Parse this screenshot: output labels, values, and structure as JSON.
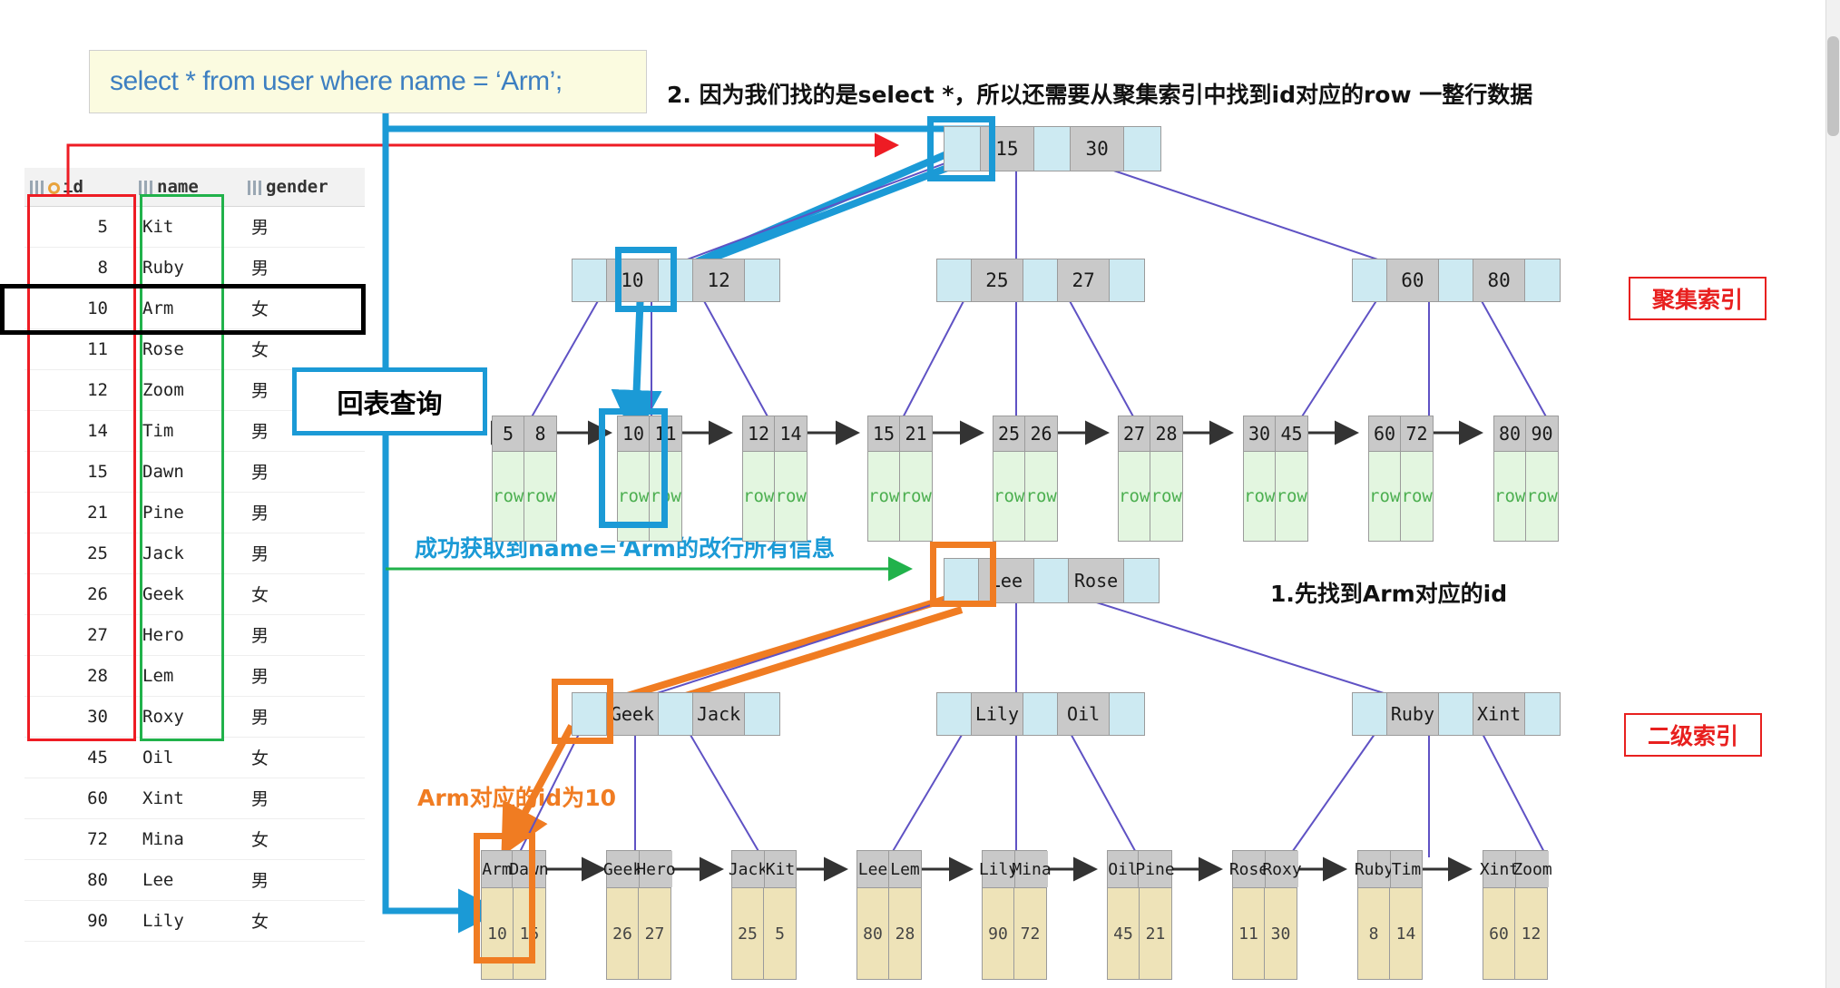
{
  "sql": {
    "query": "select * from user where name = ‘Arm’;"
  },
  "table": {
    "columns": [
      "id",
      "name",
      "gender"
    ],
    "rows": [
      [
        "5",
        "Kit",
        "男"
      ],
      [
        "8",
        "Ruby",
        "男"
      ],
      [
        "10",
        "Arm",
        "女"
      ],
      [
        "11",
        "Rose",
        "女"
      ],
      [
        "12",
        "Zoom",
        "男"
      ],
      [
        "14",
        "Tim",
        "男"
      ],
      [
        "15",
        "Dawn",
        "男"
      ],
      [
        "21",
        "Pine",
        "男"
      ],
      [
        "25",
        "Jack",
        "男"
      ],
      [
        "26",
        "Geek",
        "女"
      ],
      [
        "27",
        "Hero",
        "男"
      ],
      [
        "28",
        "Lem",
        "男"
      ],
      [
        "30",
        "Roxy",
        "男"
      ],
      [
        "45",
        "Oil",
        "女"
      ],
      [
        "60",
        "Xint",
        "男"
      ],
      [
        "72",
        "Mina",
        "女"
      ],
      [
        "80",
        "Lee",
        "男"
      ],
      [
        "90",
        "Lily",
        "女"
      ]
    ]
  },
  "annotations": {
    "step2": "2. 因为我们找的是select *，所以还需要从聚集索引中找到id对应的row 一整行数据",
    "step1": "1.先找到Arm对应的id",
    "success": "成功获取到name=‘Arm的改行所有信息",
    "arm_id": "Arm对应的id为10",
    "back_to_table": "回表查询",
    "clustered_label": "聚集索引",
    "secondary_label": "二级索引"
  },
  "clustered_index": {
    "root": [
      "15",
      "30"
    ],
    "internal": [
      [
        "10",
        "12"
      ],
      [
        "25",
        "27"
      ],
      [
        "60",
        "80"
      ]
    ],
    "leaves": [
      {
        "keys": [
          "5",
          "8"
        ],
        "vals": [
          "row",
          "row"
        ]
      },
      {
        "keys": [
          "10",
          "11"
        ],
        "vals": [
          "row",
          "row"
        ]
      },
      {
        "keys": [
          "12",
          "14"
        ],
        "vals": [
          "row",
          "row"
        ]
      },
      {
        "keys": [
          "15",
          "21"
        ],
        "vals": [
          "row",
          "row"
        ]
      },
      {
        "keys": [
          "25",
          "26"
        ],
        "vals": [
          "row",
          "row"
        ]
      },
      {
        "keys": [
          "27",
          "28"
        ],
        "vals": [
          "row",
          "row"
        ]
      },
      {
        "keys": [
          "30",
          "45"
        ],
        "vals": [
          "row",
          "row"
        ]
      },
      {
        "keys": [
          "60",
          "72"
        ],
        "vals": [
          "row",
          "row"
        ]
      },
      {
        "keys": [
          "80",
          "90"
        ],
        "vals": [
          "row",
          "row"
        ]
      }
    ]
  },
  "secondary_index": {
    "root": [
      "Lee",
      "Rose"
    ],
    "internal": [
      [
        "Geek",
        "Jack"
      ],
      [
        "Lily",
        "Oil"
      ],
      [
        "Ruby",
        "Xint"
      ]
    ],
    "leaves": [
      {
        "keys": [
          "Arm",
          "Dawn"
        ],
        "vals": [
          "10",
          "15"
        ]
      },
      {
        "keys": [
          "Geek",
          "Hero"
        ],
        "vals": [
          "26",
          "27"
        ]
      },
      {
        "keys": [
          "Jack",
          "Kit"
        ],
        "vals": [
          "25",
          "5"
        ]
      },
      {
        "keys": [
          "Lee",
          "Lem"
        ],
        "vals": [
          "80",
          "28"
        ]
      },
      {
        "keys": [
          "Lily",
          "Mina"
        ],
        "vals": [
          "90",
          "72"
        ]
      },
      {
        "keys": [
          "Oil",
          "Pine"
        ],
        "vals": [
          "45",
          "21"
        ]
      },
      {
        "keys": [
          "Rose",
          "Roxy"
        ],
        "vals": [
          "11",
          "30"
        ]
      },
      {
        "keys": [
          "Ruby",
          "Tim"
        ],
        "vals": [
          "8",
          "14"
        ]
      },
      {
        "keys": [
          "Xint",
          "Zoom"
        ],
        "vals": [
          "60",
          "12"
        ]
      }
    ]
  },
  "colors": {
    "accent_blue": "#1b9ad6",
    "accent_orange": "#f07c22",
    "red": "#ee1c24",
    "green": "#21b24b",
    "node_key": "#c9c9c9",
    "node_ptr": "#cdeaf2",
    "row_cell": "#e3f6e0",
    "id_cell": "#eee3b8"
  }
}
